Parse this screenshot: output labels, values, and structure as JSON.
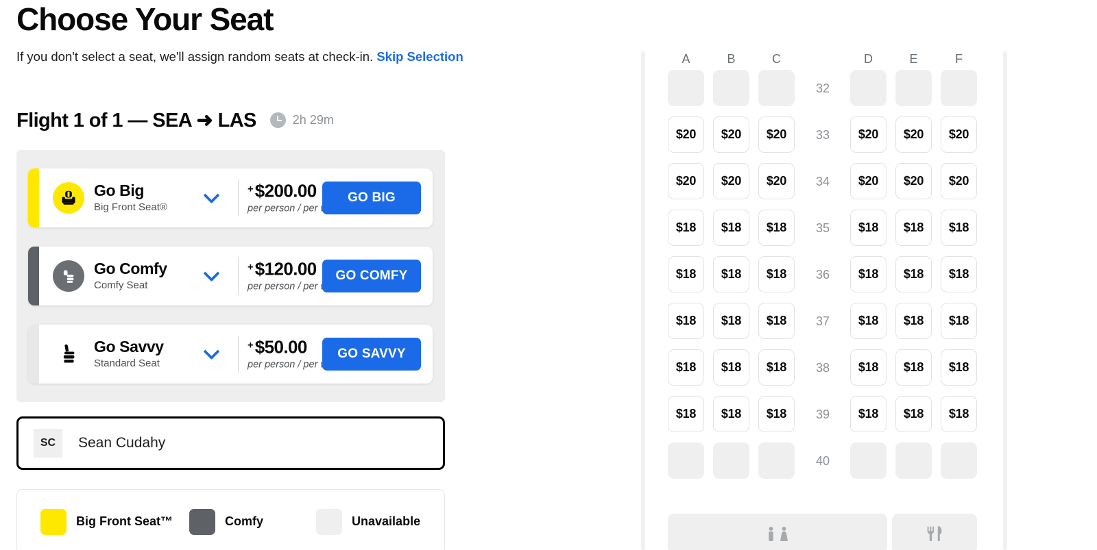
{
  "header": {
    "title": "Choose Your Seat",
    "subtitle": "If you don't select a seat, we'll assign random seats at check-in.",
    "skip_link": "Skip Selection"
  },
  "flight": {
    "label": "Flight 1 of 1 — SEA ➜ LAS",
    "duration": "2h 29m",
    "clock_icon": "clock-icon"
  },
  "fare_options": [
    {
      "name": "Go Big",
      "subtitle": "Big Front Seat®",
      "plus": "+",
      "price": "$200.00",
      "per": "per person / per way",
      "cta": "GO BIG",
      "accent_color": "#FFE800",
      "icon": "big-front-seat-icon",
      "icon_circle_color": "#FFE800",
      "icon_glyph_color": "#0a0a0a",
      "chevron_icon": "chevron-down-icon"
    },
    {
      "name": "Go Comfy",
      "subtitle": "Comfy Seat",
      "plus": "+",
      "price": "$120.00",
      "per": "per person / per way",
      "cta": "GO COMFY",
      "accent_color": "#5e6165",
      "icon": "comfy-seat-icon",
      "icon_circle_color": "#6b6f73",
      "icon_glyph_color": "#ffffff",
      "chevron_icon": "chevron-down-icon"
    },
    {
      "name": "Go Savvy",
      "subtitle": "Standard Seat",
      "plus": "+",
      "price": "$50.00",
      "per": "per person / per way",
      "cta": "GO SAVVY",
      "accent_color": "#e8e8e8",
      "icon": "standard-seat-icon",
      "icon_circle_color": "transparent",
      "icon_glyph_color": "#0a0a0a",
      "chevron_icon": "chevron-down-icon"
    }
  ],
  "passenger": {
    "initials": "SC",
    "name": "Sean Cudahy"
  },
  "legend": [
    {
      "label": "Big Front Seat™",
      "color": "#FFE800"
    },
    {
      "label": "Comfy",
      "color": "#5e6165"
    },
    {
      "label": "Unavailable",
      "color": "#efefef"
    }
  ],
  "seatmap": {
    "columns_left": [
      "A",
      "B",
      "C"
    ],
    "columns_right": [
      "D",
      "E",
      "F"
    ],
    "rows": [
      {
        "number": "32",
        "left": [
          "",
          "",
          ""
        ],
        "right": [
          "",
          "",
          ""
        ],
        "status": "unavailable"
      },
      {
        "number": "33",
        "left": [
          "$20",
          "$20",
          "$20"
        ],
        "right": [
          "$20",
          "$20",
          "$20"
        ],
        "status": "available"
      },
      {
        "number": "34",
        "left": [
          "$20",
          "$20",
          "$20"
        ],
        "right": [
          "$20",
          "$20",
          "$20"
        ],
        "status": "available"
      },
      {
        "number": "35",
        "left": [
          "$18",
          "$18",
          "$18"
        ],
        "right": [
          "$18",
          "$18",
          "$18"
        ],
        "status": "available"
      },
      {
        "number": "36",
        "left": [
          "$18",
          "$18",
          "$18"
        ],
        "right": [
          "$18",
          "$18",
          "$18"
        ],
        "status": "available"
      },
      {
        "number": "37",
        "left": [
          "$18",
          "$18",
          "$18"
        ],
        "right": [
          "$18",
          "$18",
          "$18"
        ],
        "status": "available"
      },
      {
        "number": "38",
        "left": [
          "$18",
          "$18",
          "$18"
        ],
        "right": [
          "$18",
          "$18",
          "$18"
        ],
        "status": "available"
      },
      {
        "number": "39",
        "left": [
          "$18",
          "$18",
          "$18"
        ],
        "right": [
          "$18",
          "$18",
          "$18"
        ],
        "status": "available"
      },
      {
        "number": "40",
        "left": [
          "",
          "",
          ""
        ],
        "right": [
          "",
          "",
          ""
        ],
        "status": "unavailable"
      }
    ],
    "facilities": [
      {
        "icon": "lavatory-icon"
      },
      {
        "icon": "galley-icon"
      }
    ]
  }
}
